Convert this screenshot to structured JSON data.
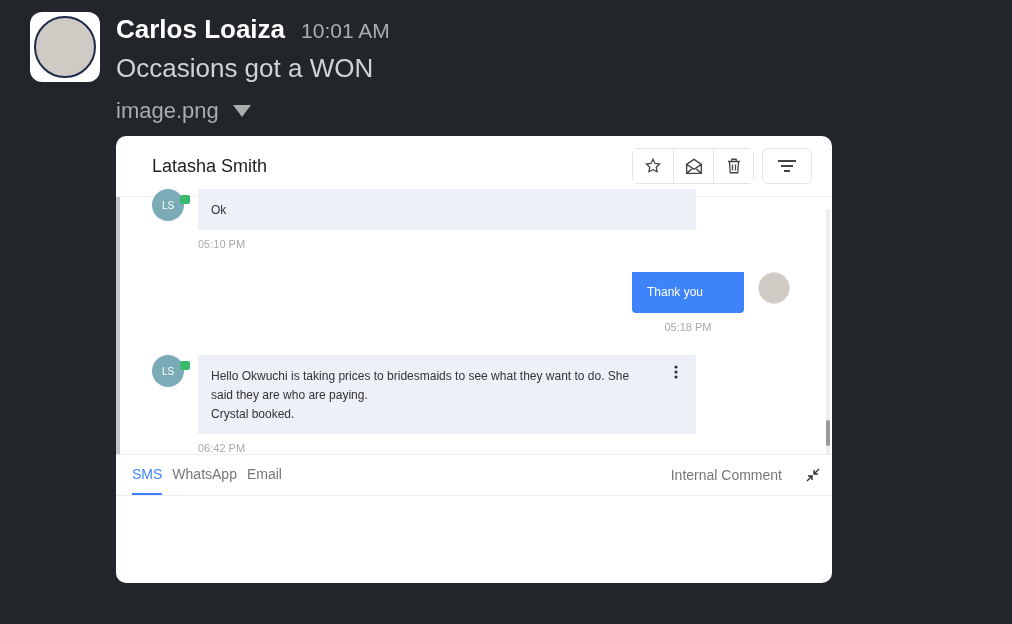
{
  "post": {
    "author": "Carlos Loaiza",
    "time": "10:01 AM",
    "text": "Occasions got a WON",
    "attachment": "image.png"
  },
  "conversation": {
    "contact": "Latasha Smith",
    "messages": [
      {
        "kind": "incoming",
        "initials": "LS",
        "text": "Ok",
        "time": "05:10 PM",
        "menu": false
      },
      {
        "kind": "outgoing",
        "text": "Thank you",
        "time": "05:18 PM",
        "menu": false
      },
      {
        "kind": "incoming",
        "initials": "LS",
        "text": "Hello Okwuchi is taking prices to bridesmaids to see what they want to do. She said they are who are paying.\nCrystal booked.",
        "time": "06:42 PM",
        "menu": true
      }
    ],
    "tabs": [
      {
        "label": "SMS",
        "selected": true
      },
      {
        "label": "WhatsApp",
        "selected": false
      },
      {
        "label": "Email",
        "selected": false
      }
    ],
    "internal_comment": "Internal Comment"
  }
}
